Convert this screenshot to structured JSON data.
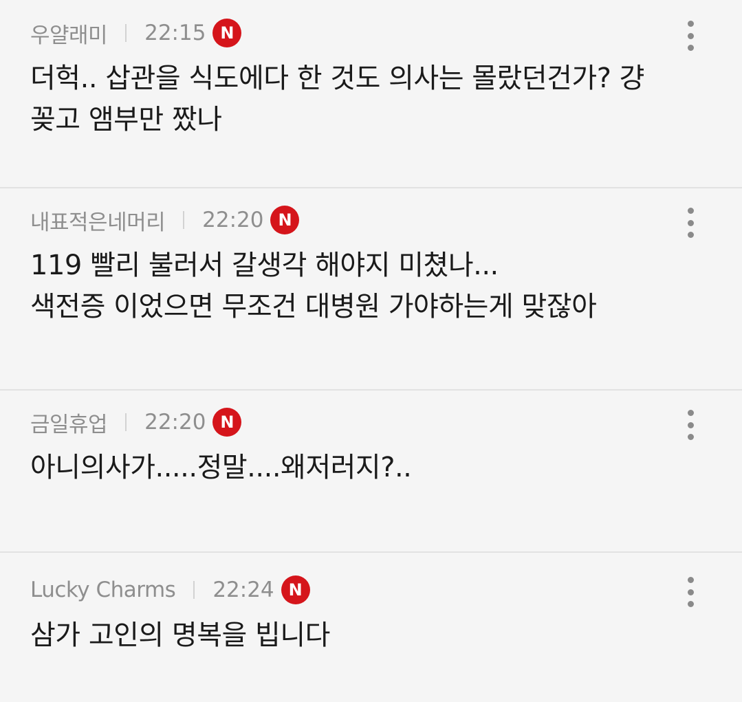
{
  "comments": [
    {
      "nickname": "우얄래미",
      "time": "22:15",
      "badge": "N",
      "text": "더헉.. 삽관을 식도에다 한 것도 의사는 몰랐던건가? 걍\n꽂고 앰부만 짰나"
    },
    {
      "nickname": "내표적은네머리",
      "time": "22:20",
      "badge": "N",
      "text": "119 빨리 불러서 갈생각 해야지 미쳤나...\n색전증 이었으면 무조건 대병원 가야하는게 맞잖아"
    },
    {
      "nickname": "금일휴업",
      "time": "22:20",
      "badge": "N",
      "text": "아니의사가.....정말....왜저러지?.."
    },
    {
      "nickname": "Lucky Charms",
      "time": "22:24",
      "badge": "N",
      "text": "삼가 고인의 명복을 빕니다"
    }
  ],
  "colors": {
    "badge": "#d5151b",
    "meta_text": "#8e8e8e",
    "body_text": "#1a1a1a",
    "background": "#f5f5f5",
    "divider": "#e2e2e2"
  },
  "icons": {
    "more": "more-vertical-icon",
    "badge": "new-badge-icon"
  }
}
